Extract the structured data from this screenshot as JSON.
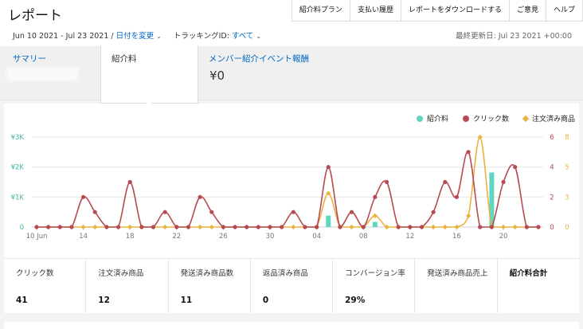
{
  "header": {
    "title": "レポート",
    "nav": [
      "紹介料プラン",
      "支払い履歴",
      "レポートをダウンロードする",
      "ご意見",
      "ヘルプ"
    ],
    "date_range": "Jun 10 2021 - Jul 23 2021 / ",
    "change_date": "日付を変更",
    "tracking_label": "トラッキングID: ",
    "tracking_value": "すべて",
    "last_updated": "最終更新日: Jul 23 2021 +00:00"
  },
  "tabs": {
    "summary": "サマリー",
    "commission": "紹介料",
    "event": "メンバー紹介イベント報酬",
    "event_value": "¥0"
  },
  "legend": [
    {
      "name": "紹介料",
      "color": "#5fd7c0"
    },
    {
      "name": "クリック数",
      "color": "#b74b53"
    },
    {
      "name": "注文済み商品",
      "color": "#e9b441"
    }
  ],
  "chart_data": {
    "type": "line",
    "x_ticks": [
      "10 Jun",
      "14",
      "18",
      "22",
      "26",
      "30",
      "04",
      "08",
      "12",
      "16",
      "20"
    ],
    "y_left_ticks": [
      "0",
      "¥1K",
      "¥2K",
      "¥3K"
    ],
    "y_right1_ticks": [
      "0",
      "2",
      "4",
      "6"
    ],
    "y_right2_ticks": [
      "0",
      "3",
      "5",
      "8"
    ],
    "ylim_left": [
      0,
      3000
    ],
    "ylim_right1": [
      0,
      6
    ],
    "ylim_right2": [
      0,
      8
    ],
    "x": [
      "Jun 10",
      "Jun 11",
      "Jun 12",
      "Jun 13",
      "Jun 14",
      "Jun 15",
      "Jun 16",
      "Jun 17",
      "Jun 18",
      "Jun 19",
      "Jun 20",
      "Jun 21",
      "Jun 22",
      "Jun 23",
      "Jun 24",
      "Jun 25",
      "Jun 26",
      "Jun 27",
      "Jun 28",
      "Jun 29",
      "Jun 30",
      "Jul 01",
      "Jul 02",
      "Jul 03",
      "Jul 04",
      "Jul 05",
      "Jul 06",
      "Jul 07",
      "Jul 08",
      "Jul 09",
      "Jul 10",
      "Jul 11",
      "Jul 12",
      "Jul 13",
      "Jul 14",
      "Jul 15",
      "Jul 16",
      "Jul 17",
      "Jul 18",
      "Jul 19",
      "Jul 20",
      "Jul 21",
      "Jul 22",
      "Jul 23"
    ],
    "series": [
      {
        "name": "紹介料",
        "type": "bar",
        "axis": "left",
        "color": "#5fd7c0",
        "values": [
          0,
          0,
          0,
          0,
          0,
          0,
          0,
          0,
          0,
          0,
          0,
          0,
          0,
          0,
          0,
          0,
          0,
          0,
          0,
          0,
          0,
          0,
          0,
          0,
          0,
          380,
          0,
          0,
          0,
          170,
          0,
          0,
          0,
          0,
          0,
          0,
          0,
          0,
          0,
          1820,
          0,
          0,
          0,
          0
        ]
      },
      {
        "name": "クリック数",
        "type": "line",
        "axis": "right1",
        "color": "#b74b53",
        "values": [
          0,
          0,
          0,
          0,
          2,
          1,
          0,
          0,
          3,
          0,
          0,
          1,
          0,
          0,
          2,
          1,
          0,
          0,
          0,
          0,
          0,
          0,
          1,
          0,
          0,
          4,
          0,
          1,
          0,
          2,
          3,
          0,
          0,
          0,
          1,
          3,
          2,
          5,
          0,
          0,
          3,
          4,
          0,
          0
        ]
      },
      {
        "name": "注文済み商品",
        "type": "line",
        "axis": "right2",
        "color": "#e9b441",
        "values": [
          0,
          0,
          0,
          0,
          0,
          0,
          0,
          0,
          0,
          0,
          0,
          0,
          0,
          0,
          0,
          0,
          0,
          0,
          0,
          0,
          0,
          0,
          0,
          0,
          0,
          3,
          0,
          0,
          0,
          1,
          0,
          0,
          0,
          0,
          0,
          0,
          0,
          1,
          8,
          0,
          0,
          0,
          0,
          0
        ]
      }
    ]
  },
  "stats": [
    {
      "label": "クリック数",
      "value": "41"
    },
    {
      "label": "注文済み商品",
      "value": "12"
    },
    {
      "label": "発送済み商品数",
      "value": "11"
    },
    {
      "label": "返品済み商品",
      "value": "0"
    },
    {
      "label": "コンバージョン率",
      "value": "29%"
    },
    {
      "label": "発送済み商品売上",
      "value": ""
    },
    {
      "label": "紹介料合計",
      "value": ""
    }
  ]
}
